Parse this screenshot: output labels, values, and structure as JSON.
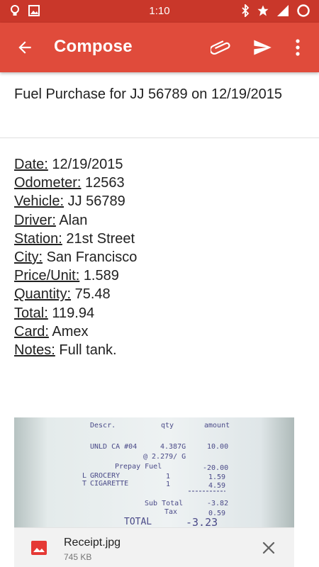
{
  "status_bar": {
    "time": "1:10",
    "icons": [
      "lightbulb-icon",
      "image-icon",
      "bluetooth-icon",
      "star-icon",
      "signal-icon",
      "battery-icon"
    ]
  },
  "app_bar": {
    "title": "Compose",
    "icons": [
      "back-arrow-icon",
      "paperclip-icon",
      "send-icon",
      "more-vert-icon"
    ],
    "color": "#e04b3b",
    "status_color": "#c9372a"
  },
  "compose": {
    "subject": "Fuel Purchase for JJ 56789 on 12/19/2015",
    "fields": [
      {
        "label": "Date:",
        "value": "12/19/2015"
      },
      {
        "label": "Odometer:",
        "value": "12563"
      },
      {
        "label": "Vehicle:",
        "value": "JJ 56789"
      },
      {
        "label": "Driver:",
        "value": "Alan"
      },
      {
        "label": "Station:",
        "value": "21st Street"
      },
      {
        "label": "City:",
        "value": "San Francisco"
      },
      {
        "label": "Price/Unit:",
        "value": "1.589"
      },
      {
        "label": "Quantity:",
        "value": "75.48"
      },
      {
        "label": "Total:",
        "value": "119.94"
      },
      {
        "label": "Card:",
        "value": "Amex"
      },
      {
        "label": "Notes:",
        "value": "Full tank."
      }
    ]
  },
  "attachment": {
    "file_name": "Receipt.jpg",
    "file_size": "745 KB",
    "icon": "image-file-icon",
    "icon_color": "#e53935",
    "receipt": {
      "headers": [
        "Descr.",
        "qty",
        "amount"
      ],
      "line1": {
        "desc": "UNLD CA #04",
        "qty": "4.387G",
        "amount": "10.00"
      },
      "unit_price": "@ 2.279/ G",
      "prepay": {
        "desc": "Prepay Fuel",
        "amount": "-20.00"
      },
      "item1": {
        "flag": "L",
        "desc": "GROCERY",
        "qty": "1",
        "amount": "1.59"
      },
      "item2": {
        "flag": "T",
        "desc": "CIGARETTE",
        "qty": "1",
        "amount": "4.59"
      },
      "subtotal": {
        "label": "Sub Total",
        "amount": "-3.82"
      },
      "tax": {
        "label": "Tax",
        "amount": "0.59"
      },
      "total": {
        "label": "TOTAL",
        "amount": "-3.23"
      }
    }
  }
}
